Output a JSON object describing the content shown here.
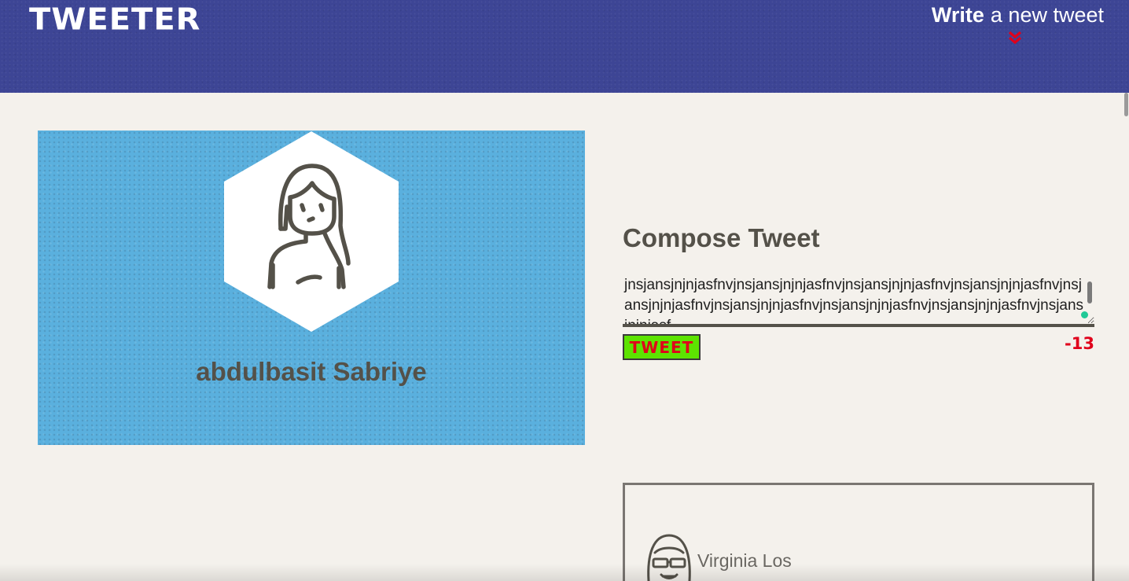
{
  "nav": {
    "brand": "TWEETER",
    "write_strong": "Write",
    "write_rest": "a new tweet",
    "chevron_icon": "double-chevron-down-icon"
  },
  "profile": {
    "name": "abdulbasit Sabriye",
    "avatar_icon": "woman-avatar-icon"
  },
  "compose": {
    "title": "Compose Tweet",
    "text": "jnsjansjnjnjasfnvjnsjansjnjnjasfnvjnsjansjnjnjasfnvjnsjansjnjnjasfnvjnsjansjnjnjasfnvjnsjansjnjnjasfnvjnsjansjnjnjasfnvjnsjansjnjnjasfnvjnsjansjnjnjasf",
    "button": "TWEET",
    "counter": "-13"
  },
  "tweets": [
    {
      "author": "Virginia Los",
      "avatar_icon": "sunglasses-avatar-icon"
    }
  ],
  "colors": {
    "nav_bg": "#3d4595",
    "profile_bg": "#5ab0de",
    "page_bg": "#f4f1ec",
    "text": "#545149",
    "button_bg": "#5de301",
    "accent_red": "#e0001b"
  }
}
